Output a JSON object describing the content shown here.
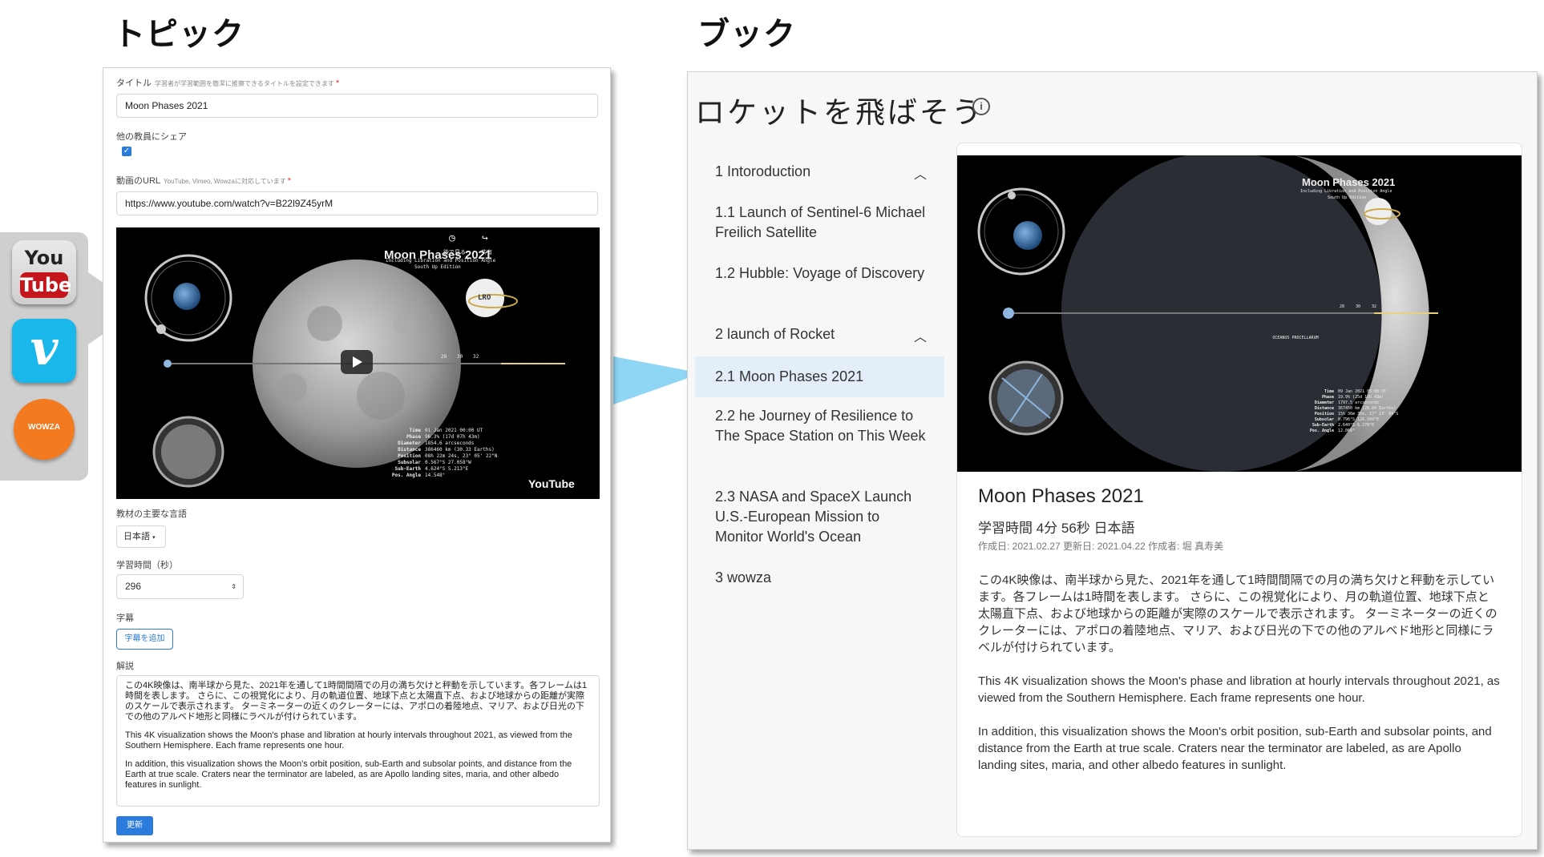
{
  "headings": {
    "topic": "トピック",
    "book": "ブック"
  },
  "form": {
    "title_label": "タイトル",
    "title_hint": "学習者が学習範囲を簡潔に推察できるタイトルを設定できます",
    "title_required": "*",
    "title_value": "Moon Phases 2021",
    "share_label": "他の教員にシェア",
    "share_checked": "✓",
    "url_label": "動画のURL",
    "url_hint": "YouTube, Vimeo, Wowzaに対応しています",
    "url_required": "*",
    "url_value": "https://www.youtube.com/watch?v=B22l9Z45yrM",
    "language_label": "教材の主要な言語",
    "language_value": "日本語",
    "duration_label": "学習時間（秒）",
    "duration_value": "296",
    "subtitle_label": "字幕",
    "subtitle_button": "字幕を追加",
    "desc_label": "解説",
    "desc_p1": "この4K映像は、南半球から見た、2021年を通して1時間間隔での月の満ち欠けと秤動を示しています。各フレームは1時間を表します。 さらに、この視覚化により、月の軌道位置、地球下点と太陽直下点、および地球からの距離が実際のスケールで表示されます。 ターミネーターの近くのクレーターには、アポロの着陸地点、マリア、および日光の下での他のアルベド地形と同様にラベルが付けられています。",
    "desc_p2": "This 4K visualization shows the Moon's phase and libration at hourly intervals throughout 2021, as viewed from the Southern Hemisphere. Each frame represents one hour.",
    "desc_p3": "In addition, this visualization shows the Moon's orbit position, sub-Earth and subsolar points, and distance from the Earth at true scale. Craters near the terminator are labeled, as are Apollo landing sites, maria, and other albedo features in sunlight.",
    "update_button": "更新"
  },
  "video_overlay": {
    "title": "Moon Phases 2021",
    "subtitle": "Including Libration and Position Angle",
    "edition": "South Up Edition",
    "lro": "LRO",
    "watch_later": "後で見る",
    "share": "共有",
    "youtube": "YouTube",
    "stats_labels": [
      "Time",
      "Phase",
      "Diameter",
      "Distance",
      "Position",
      "Subsolar",
      "Sub-Earth",
      "Pos. Angle"
    ],
    "stats_values": [
      "01 Jan 2021 00:00 UT",
      "96.3% (17d 07h 43m)",
      "1854.6 arcseconds",
      "386460 km (30.33 Earths)",
      "08h 22m 24s, 23° 05' 22\"N",
      "0.567°S 27.058°W",
      "4.624°S 5.213°E",
      "14.548°"
    ],
    "axis_ticks": [
      "28",
      "30",
      "32"
    ]
  },
  "providers": [
    "YouTube",
    "Vimeo",
    "WOWZA"
  ],
  "provider_labels": {
    "yt_top": "You",
    "yt_bottom": "Tube",
    "vimeo": "v",
    "wowza": "WOWZA"
  },
  "book": {
    "title": "ロケットを飛ばそう",
    "info_icon": "i",
    "toc": [
      {
        "label": "1 Intoroduction",
        "chevron": "^"
      },
      {
        "label": "1.1 Launch of Sentinel-6 Michael Freilich Satellite"
      },
      {
        "label": "1.2 Hubble: Voyage of Discovery"
      },
      {
        "label": "2 launch of Rocket",
        "chevron": "^"
      },
      {
        "label": "2.1 Moon Phases 2021"
      },
      {
        "label": "2.2 he Journey of Resilience to The Space Station on This Week"
      },
      {
        "label": "2.3 NASA and SpaceX Launch U.S.-European Mission to Monitor World's Ocean"
      },
      {
        "label": "3 wowza"
      }
    ],
    "card": {
      "title": "Moon Phases 2021",
      "meta": "学習時間 4分 56秒  日本語",
      "dates": "作成日: 2021.02.27  更新日: 2021.04.22  作成者: 堀 真寿美",
      "desc_p1": "この4K映像は、南半球から見た、2021年を通して1時間間隔での月の満ち欠けと秤動を示しています。各フレームは1時間を表します。 さらに、この視覚化により、月の軌道位置、地球下点と太陽直下点、および地球からの距離が実際のスケールで表示されます。 ターミネーターの近くのクレーターには、アポロの着陸地点、マリア、および日光の下での他のアルベド地形と同様にラベルが付けられています。",
      "desc_p2": "This 4K visualization shows the Moon's phase and libration at hourly intervals throughout 2021, as viewed from the Southern Hemisphere. Each frame represents one hour.",
      "desc_p3": "In addition, this visualization shows the Moon's orbit position, sub-Earth and subsolar points, and distance from the Earth at true scale. Craters near the terminator are labeled, as are Apollo landing sites, maria, and other albedo features in sunlight.",
      "video_title": "Moon Phases 2021",
      "video_subtitle": "Including Libration and Position Angle",
      "video_edition": "South Up Edition",
      "stats_labels": [
        "Time",
        "Phase",
        "Diameter",
        "Distance",
        "Position",
        "Subsolar",
        "Sub-Earth",
        "Pos. Angle"
      ],
      "stats_values": [
        "09 Jan 2021 05:00 UT",
        "19.9% (25d 12h 43m)",
        "1797.5 arcseconds",
        "367450 km (28.84 Earths)",
        "15h 36m 30s, 17° 13' 04\"S",
        "0.796°S 126.569°E",
        "2.640°S 6.278°E",
        "12.066°"
      ],
      "axis_ticks": [
        "28",
        "30",
        "32"
      ],
      "maria_label": "OCEANUS PROCELLARUM"
    }
  },
  "colors": {
    "accent": "#2b7bdc",
    "active_row": "#e3eef9",
    "arrow": "#8fd6f4"
  }
}
